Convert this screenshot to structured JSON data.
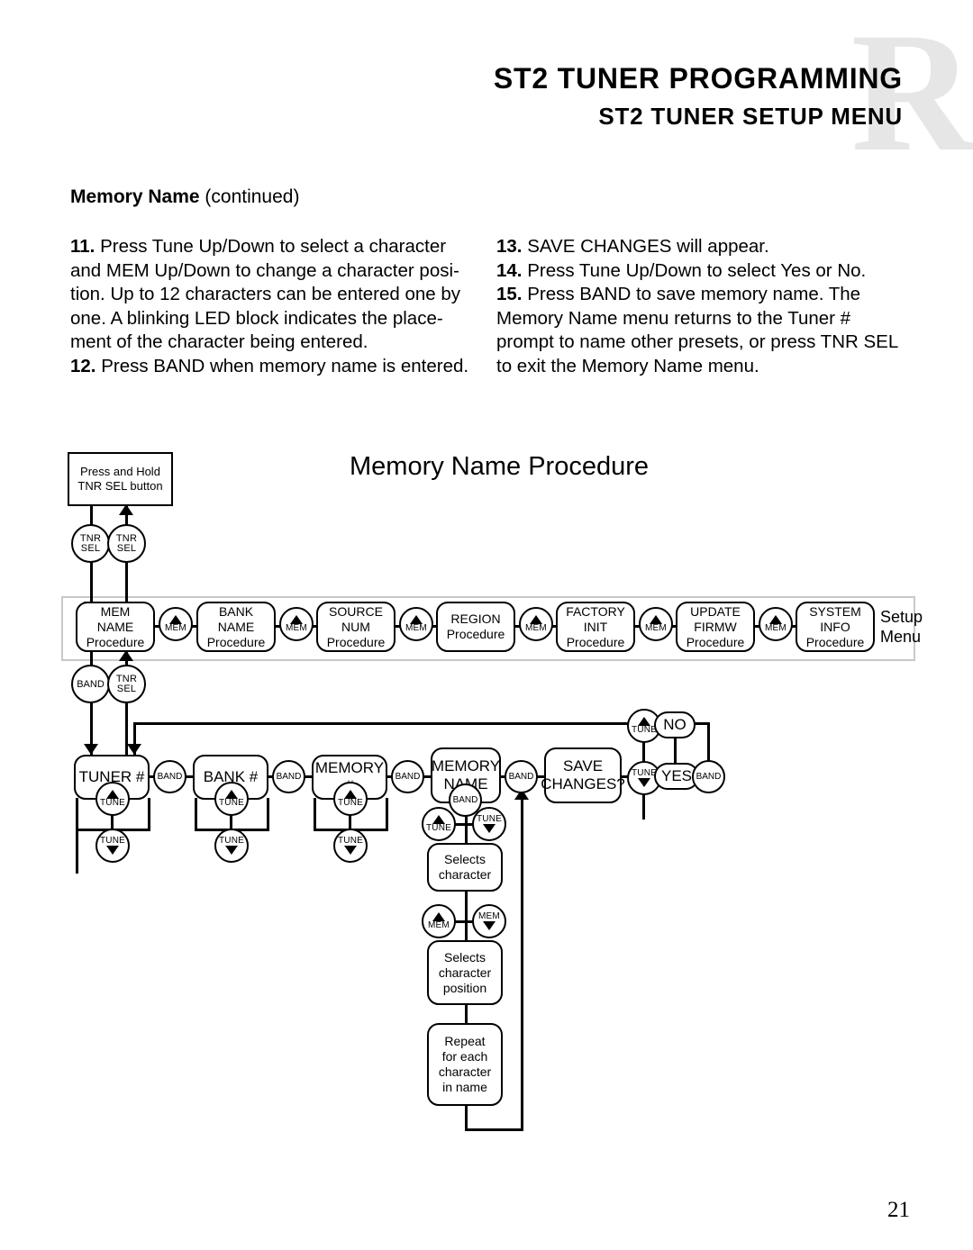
{
  "header": {
    "watermark": "R",
    "title_main": "ST2 TUNER PROGRAMMING",
    "title_sub": "ST2 TUNER SETUP MENU"
  },
  "section": {
    "heading_bold": "Memory Name",
    "heading_rest": " (continued)"
  },
  "body": {
    "left_column": [
      {
        "num": "11.",
        "text": " Press Tune Up/Down to select a character and MEM Up/Down to change a character posi-tion. Up to 12 characters can be entered one by one. A blinking LED block indicates the place-ment of the character being entered."
      },
      {
        "num": "12.",
        "text": " Press BAND when memory name is entered."
      }
    ],
    "right_column": [
      {
        "num": "13.",
        "text": " SAVE CHANGES will appear."
      },
      {
        "num": "14.",
        "text": " Press Tune Up/Down to select Yes or No."
      },
      {
        "num": "15.",
        "text": " Press BAND to save memory name. The Memory Name menu returns to the Tuner # prompt to name other presets, or press TNR SEL to exit the Memory Name menu."
      }
    ]
  },
  "diagram": {
    "title": "Memory Name Procedure",
    "press_hold_box": "Press and Hold\nTNR SEL button",
    "tnr_sel_down": {
      "l1": "TNR",
      "l2": "SEL"
    },
    "tnr_sel_up": {
      "l1": "TNR",
      "l2": "SEL"
    },
    "band_button": "BAND",
    "tnr_sel_button": {
      "l1": "TNR",
      "l2": "SEL"
    },
    "setup_menu_label": "Setup\nMenu",
    "mem_button": "MEM",
    "tune_button": "TUNE",
    "menu_items": [
      {
        "l1": "MEM",
        "l2": "NAME",
        "l3": "Procedure"
      },
      {
        "l1": "BANK",
        "l2": "NAME",
        "l3": "Procedure"
      },
      {
        "l1": "SOURCE",
        "l2": "NUM",
        "l3": "Procedure"
      },
      {
        "l1": "REGION",
        "l2": "",
        "l3": "Procedure"
      },
      {
        "l1": "FACTORY",
        "l2": "INIT",
        "l3": "Procedure"
      },
      {
        "l1": "UPDATE",
        "l2": "FIRMW",
        "l3": "Procedure"
      },
      {
        "l1": "SYSTEM",
        "l2": "INFO",
        "l3": "Procedure"
      }
    ],
    "flow_items": [
      {
        "label": "TUNER #"
      },
      {
        "label": "BANK #"
      },
      {
        "label": "MEMORY #"
      },
      {
        "l1": "MEMORY",
        "l2": "NAME"
      },
      {
        "l1": "SAVE",
        "l2": "CHANGES?"
      }
    ],
    "answer_no": "NO",
    "answer_yes": "YES",
    "selects_character": "Selects\ncharacter",
    "selects_character_position": "Selects\ncharacter\nposition",
    "repeat_box": "Repeat\nfor each\ncharacter\nin name"
  },
  "page_number": "21"
}
